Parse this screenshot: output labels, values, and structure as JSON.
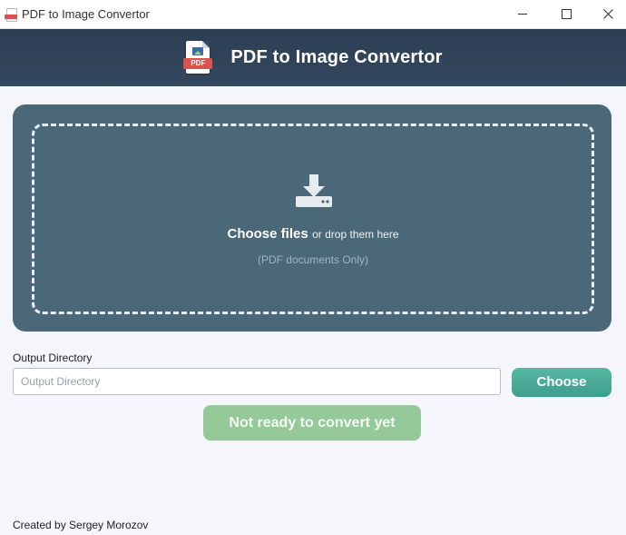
{
  "window": {
    "title": "PDF to Image Convertor",
    "controls": [
      "minimize",
      "maximize",
      "close"
    ]
  },
  "header": {
    "title": "PDF to Image Convertor",
    "logo_label": "PDF",
    "icon": "pdf-file-icon"
  },
  "dropzone": {
    "icon": "download-icon",
    "choose_text": "Choose files",
    "drop_text": "or drop them here",
    "hint": "(PDF documents Only)"
  },
  "output": {
    "label": "Output Directory",
    "placeholder": "Output Directory",
    "value": "",
    "choose_label": "Choose"
  },
  "convert": {
    "label": "Not ready to convert yet",
    "enabled": false
  },
  "footer": {
    "text": "Created by Sergey Morozov"
  },
  "colors": {
    "header_bg": "#2c3e54",
    "dropzone_bg": "#4a6878",
    "choose_button": "#4aab97",
    "convert_button_disabled": "#96c99a",
    "pdf_red": "#d9534f"
  }
}
